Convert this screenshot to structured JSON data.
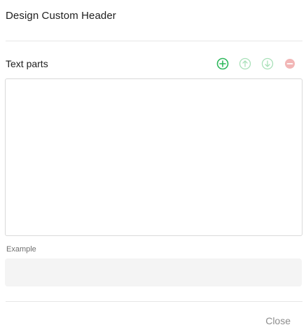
{
  "dialog": {
    "title": "Design Custom Header",
    "close_label": "Close"
  },
  "text_parts": {
    "title": "Text parts",
    "toolbar": [
      {
        "icon": "add-circle-icon",
        "state": "enabled",
        "color": "#2eb85c"
      },
      {
        "icon": "arrow-up-circle-icon",
        "state": "disabled",
        "color": "#a8e0b8"
      },
      {
        "icon": "arrow-down-circle-icon",
        "state": "disabled",
        "color": "#a8e0b8"
      },
      {
        "icon": "remove-circle-icon",
        "state": "disabled",
        "color": "#f2b6b6"
      }
    ]
  },
  "example": {
    "label": "Example",
    "value": ""
  }
}
